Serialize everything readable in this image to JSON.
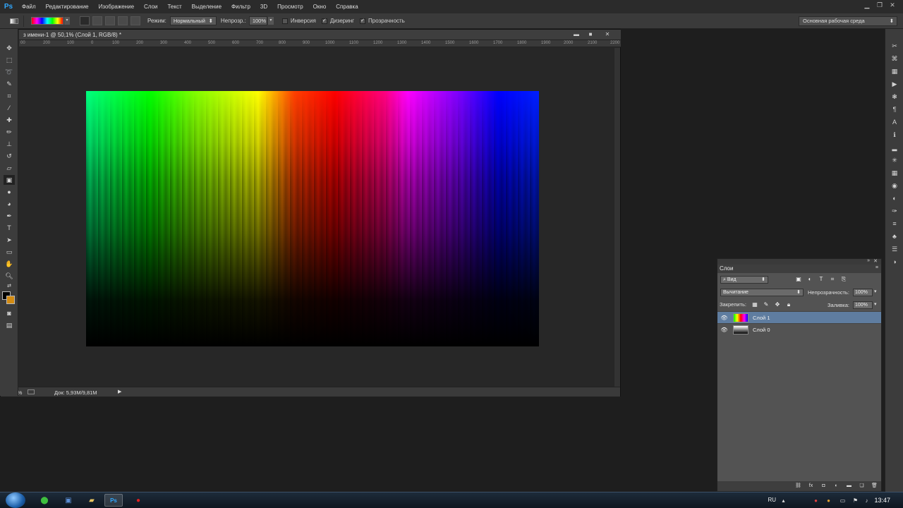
{
  "app": {
    "logo": "Ps"
  },
  "menu": [
    "Файл",
    "Редактирование",
    "Изображение",
    "Слои",
    "Текст",
    "Выделение",
    "Фильтр",
    "3D",
    "Просмотр",
    "Окно",
    "Справка"
  ],
  "options": {
    "mode_label": "Режим:",
    "mode_value": "Нормальный",
    "opacity_label": "Непрозр.:",
    "opacity_value": "100%",
    "invert_label": "Инверсия",
    "dither_label": "Дизеринг",
    "transparency_label": "Прозрачность",
    "workspace": "Основная рабочая среда"
  },
  "document": {
    "title": "з имени-1 @ 50,1% (Слой 1, RGB/8) *",
    "zoom": "50,09%",
    "doc_info": "Док: 5,93M/9,81M",
    "ruler_ticks": [
      "00",
      "200",
      "100",
      "0",
      "100",
      "200",
      "300",
      "400",
      "500",
      "600",
      "700",
      "800",
      "900",
      "1000",
      "1100",
      "1200",
      "1300",
      "1400",
      "1500",
      "1600",
      "1700",
      "1800",
      "1900",
      "2000",
      "2100",
      "2200"
    ]
  },
  "layers": {
    "tab": "Слои",
    "filter": "Вид",
    "blend_mode": "Вычитание",
    "opacity_label": "Непрозрачность:",
    "opacity_value": "100%",
    "lock_label": "Закрепить:",
    "fill_label": "Заливка:",
    "fill_value": "100%",
    "items": [
      {
        "name": "Слой 1",
        "selected": true
      },
      {
        "name": "Слой 0",
        "selected": false
      }
    ]
  },
  "colors": {
    "foreground": "#000000",
    "background": "#d38b12",
    "selection": "#5f7da0"
  },
  "taskbar": {
    "lang": "RU",
    "time": "13:47"
  }
}
